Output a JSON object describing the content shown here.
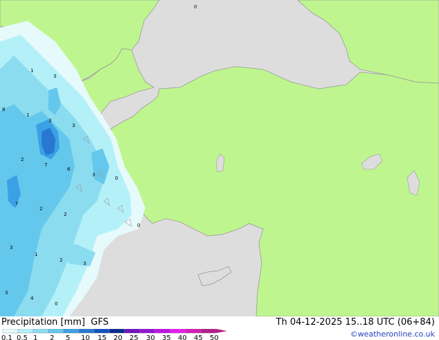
{
  "map": {
    "colors": {
      "sea": "#dddddd",
      "land": "#bff58e",
      "coast": "#999999",
      "precip_scale": [
        "#e6fafc",
        "#b4f0f8",
        "#8cdcf0",
        "#64c8ec",
        "#3ca0e6",
        "#2878d2",
        "#1450be",
        "#0a288c",
        "#6e14be",
        "#9614d2",
        "#be14e6",
        "#e61ef0",
        "#d21eb4",
        "#b41e8c"
      ]
    },
    "point_values": [
      "0",
      "1",
      "3",
      "1",
      "3",
      "3",
      "7",
      "2",
      "6",
      "3",
      "0",
      "7",
      "2",
      "2",
      "0",
      "3",
      "1",
      "2",
      "3",
      "3",
      "4",
      "0",
      "8"
    ]
  },
  "footer": {
    "title": "Precipitation [mm]  GFS",
    "validity": "Th 04-12-2025 15..18 UTC (06+84)",
    "credit": "©weatheronline.co.uk"
  },
  "legend": {
    "ticks": [
      "0.1",
      "0.5",
      "1",
      "2",
      "5",
      "10",
      "15",
      "20",
      "25",
      "30",
      "35",
      "40",
      "45",
      "50"
    ]
  }
}
